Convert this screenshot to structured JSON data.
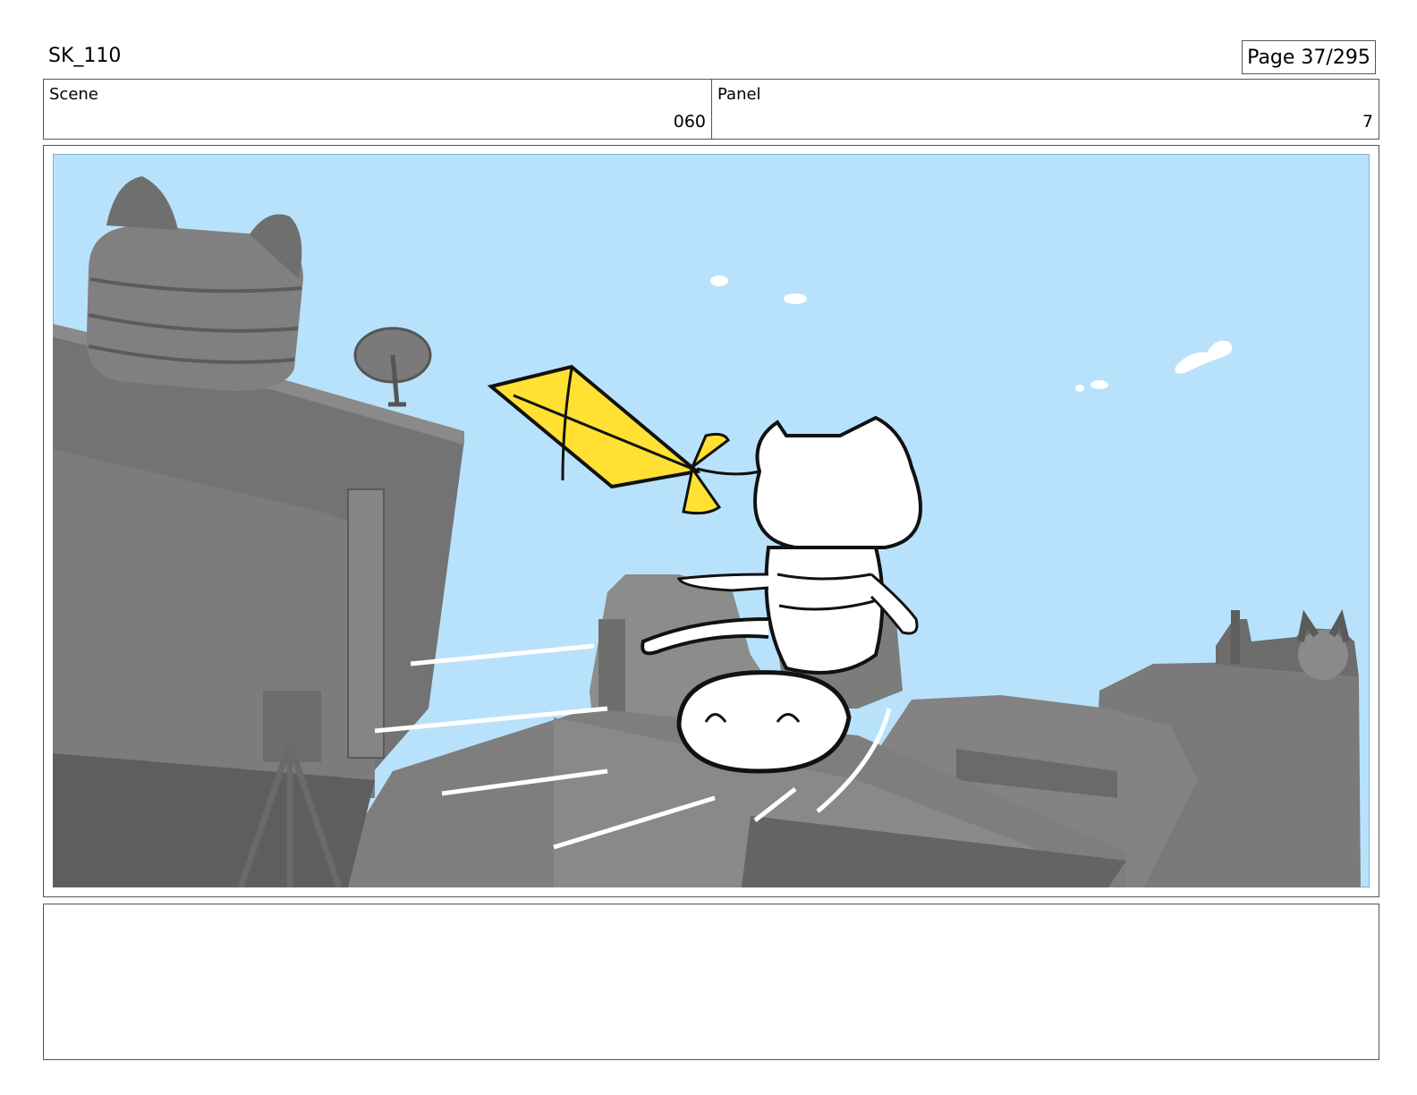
{
  "header": {
    "sheet_id": "SK_110",
    "page_label": "Page  37/295"
  },
  "info": {
    "scene_label": "Scene",
    "scene_value": "060",
    "panel_label": "Panel",
    "panel_value": "7"
  },
  "artwork": {
    "sky_color": "#b8e2fb",
    "kite_color": "#ffe033",
    "building_color": "#707070"
  },
  "notes": {
    "text": ""
  }
}
